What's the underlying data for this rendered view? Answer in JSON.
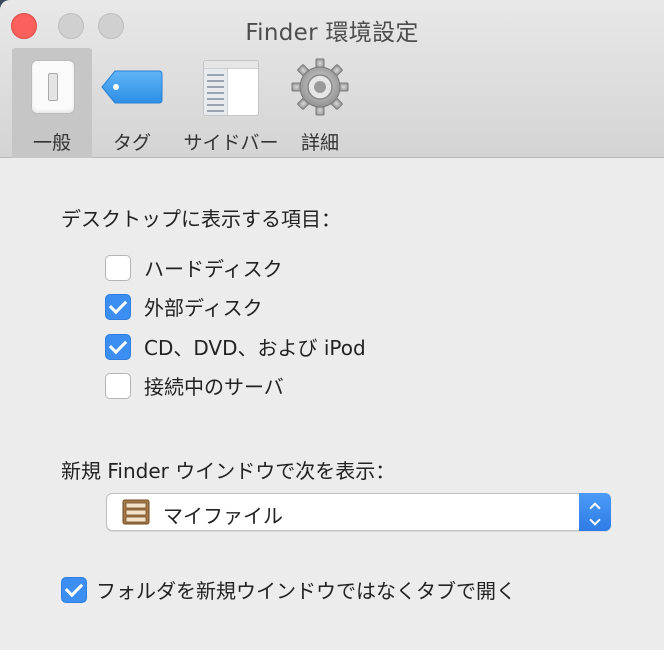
{
  "window": {
    "title": "Finder 環境設定"
  },
  "toolbar": {
    "tabs": [
      {
        "label": "一般",
        "icon": "general-switch-icon",
        "selected": true
      },
      {
        "label": "タグ",
        "icon": "tag-icon",
        "selected": false
      },
      {
        "label": "サイドバー",
        "icon": "sidebar-icon",
        "selected": false
      },
      {
        "label": "詳細",
        "icon": "gear-icon",
        "selected": false
      }
    ]
  },
  "desktop_section": {
    "heading": "デスクトップに表示する項目：",
    "items": [
      {
        "label": "ハードディスク",
        "checked": false
      },
      {
        "label": "外部ディスク",
        "checked": true
      },
      {
        "label": "CD、DVD、および iPod",
        "checked": true
      },
      {
        "label": "接続中のサーバ",
        "checked": false
      }
    ]
  },
  "new_window_section": {
    "heading": "新規 Finder ウインドウで次を表示：",
    "selected_value": "マイファイル"
  },
  "open_folders_option": {
    "label": "フォルダを新規ウインドウではなくタブで開く",
    "checked": true
  },
  "colors": {
    "accent": "#3d8ef3",
    "close_button": "#fc605c"
  }
}
